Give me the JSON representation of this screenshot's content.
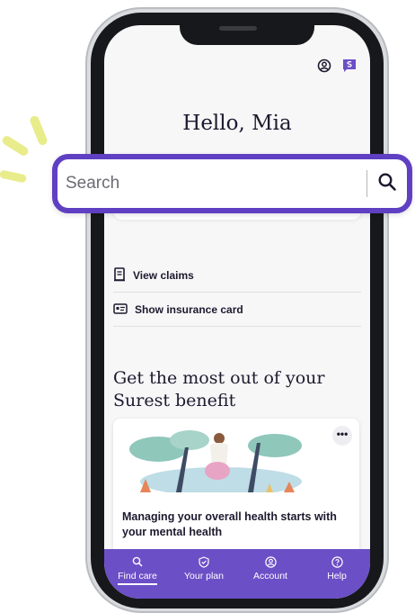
{
  "header": {
    "icons": [
      "profile-icon",
      "chat-icon"
    ]
  },
  "greeting": "Hello, Mia",
  "search": {
    "placeholder": "Search",
    "button_icon": "search-icon"
  },
  "quick_links": [
    {
      "label": "View claims",
      "icon": "receipt-icon"
    },
    {
      "label": "Show insurance card",
      "icon": "id-card-icon"
    }
  ],
  "promo": {
    "title": "Get the most out of your Surest benefit"
  },
  "article": {
    "title": "Managing your overall health starts with your mental health",
    "menu_icon": "more-icon"
  },
  "bottom_nav": [
    {
      "label": "Find care",
      "icon": "search-icon",
      "active": true
    },
    {
      "label": "Your plan",
      "icon": "shield-check-icon",
      "active": false
    },
    {
      "label": "Account",
      "icon": "account-icon",
      "active": false
    },
    {
      "label": "Help",
      "icon": "help-icon",
      "active": false
    }
  ],
  "colors": {
    "brand_purple": "#6b4fc6",
    "callout_border": "#5f3fc2",
    "sparkle": "#e8ec8a"
  }
}
